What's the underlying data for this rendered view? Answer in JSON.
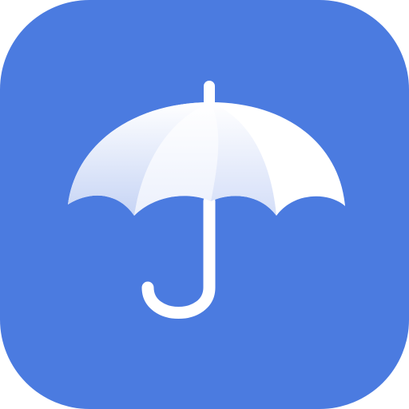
{
  "app_icon": {
    "icon": "umbrella-icon",
    "colors": {
      "background": "#4B7BE0",
      "canopy_light": "#FFFFFF",
      "canopy_shade": "#C9D6F6",
      "handle": "#FFFFFF"
    }
  }
}
